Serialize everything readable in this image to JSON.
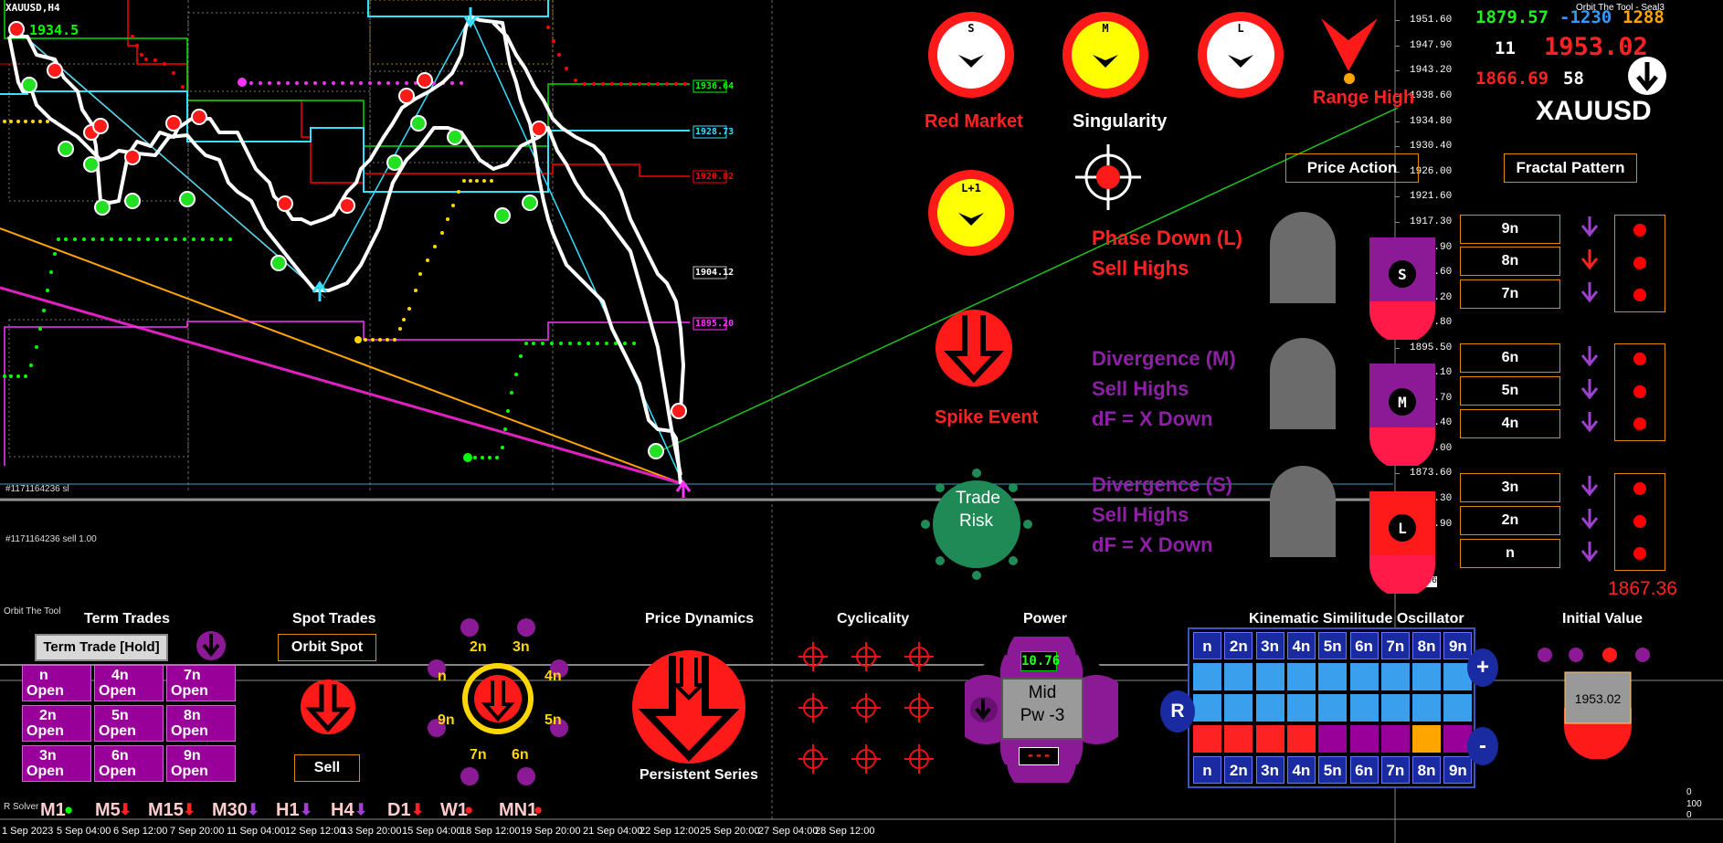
{
  "chart": {
    "symbol_label": "XAUUSD,H4",
    "indicator_title": "Orbit The Tool - Seal3",
    "level_green_label": "1934.5",
    "price_tags": [
      "1936.64",
      "1928.73",
      "1920.82",
      "1904.12",
      "1895.20"
    ],
    "trade_line_sl": "#1171164236 sl",
    "trade_line_sell": "#1171164236 sell 1.00",
    "current_price_large": "1867.36",
    "current_price_tag": "1867.36",
    "price_axis": [
      "1951.60",
      "1947.90",
      "1943.20",
      "1938.60",
      "1934.80",
      "1930.40",
      "1926.00",
      "1921.60",
      "1917.30",
      "1912.90",
      "1908.60",
      "1904.20",
      "1899.80",
      "1895.50",
      "1891.10",
      "1886.70",
      "1882.40",
      "1878.00",
      "1873.60",
      "1869.30",
      "1864.90"
    ],
    "colors": {
      "white": "#ffffff",
      "red": "#ff0000",
      "green": "#00ff00",
      "cyan": "#33e0ff",
      "magenta": "#ff33ff",
      "yellow": "#ffd700",
      "orange": "#ffa500"
    }
  },
  "header_stats": {
    "v1": "1879.57",
    "v2": "-1230",
    "v3": "1288",
    "v4": "11",
    "v5": "1953.02",
    "v6": "1866.69",
    "v7": "58",
    "symbol": "XAUUSD"
  },
  "dials": {
    "s_label": "S",
    "m_label": "M",
    "l_label": "L",
    "lp1_label": "L+1",
    "red_market": "Red Market",
    "singularity": "Singularity",
    "range_high": "Range High",
    "spike_event": "Spike Event",
    "trade_risk_line1": "Trade",
    "trade_risk_line2": "Risk"
  },
  "buttons": {
    "price_action": "Price Action",
    "fractal_pattern": "Fractal Pattern"
  },
  "phases": [
    {
      "line1": "Phase Down (L)",
      "line2": "Sell Highs",
      "line3": "",
      "badge": "S",
      "color": "#ff2222"
    },
    {
      "line1": "Divergence (M)",
      "line2": "Sell Highs",
      "line3": "dF = X Down",
      "badge": "M",
      "color": "#8e1fa6"
    },
    {
      "line1": "Divergence (S)",
      "line2": "Sell Highs",
      "line3": "dF = X Down",
      "badge": "L",
      "color": "#8e1fa6"
    }
  ],
  "fractal_rows": [
    "9n",
    "8n",
    "7n",
    "6n",
    "5n",
    "4n",
    "3n",
    "2n",
    "n"
  ],
  "bottom": {
    "panel_label": "Orbit The Tool",
    "term_trades": {
      "title": "Term Trades",
      "hold_button": "Term Trade [Hold]",
      "tiles": [
        {
          "n": "n",
          "state": "Open"
        },
        {
          "n": "4n",
          "state": "Open"
        },
        {
          "n": "7n",
          "state": "Open"
        },
        {
          "n": "2n",
          "state": "Open"
        },
        {
          "n": "5n",
          "state": "Open"
        },
        {
          "n": "8n",
          "state": "Open"
        },
        {
          "n": "3n",
          "state": "Open"
        },
        {
          "n": "6n",
          "state": "Open"
        },
        {
          "n": "9n",
          "state": "Open"
        }
      ]
    },
    "spot_trades": {
      "title": "Spot Trades",
      "orbit_spot": "Orbit Spot",
      "sell": "Sell"
    },
    "orbit_ring": {
      "labels": [
        "2n",
        "3n",
        "4n",
        "5n",
        "6n",
        "7n",
        "9n",
        "n"
      ]
    },
    "price_dynamics": {
      "title": "Price Dynamics",
      "caption": "Persistent Series"
    },
    "cyclicality": {
      "title": "Cyclicality"
    },
    "power": {
      "title": "Power",
      "value": "10.76",
      "line1": "Mid",
      "line2": "Pw -3",
      "bottom": "---"
    },
    "kso": {
      "title": "Kinematic Similitude Oscillator",
      "header": [
        "n",
        "2n",
        "3n",
        "4n",
        "5n",
        "6n",
        "7n",
        "8n",
        "9n"
      ],
      "r_label": "R",
      "plus": "+",
      "minus": "-",
      "row3_colors": [
        "#ff2222",
        "#ff2222",
        "#ff2222",
        "#ff2222",
        "#990099",
        "#990099",
        "#990099",
        "#ffa500",
        "#990099"
      ]
    },
    "initial_value": {
      "title": "Initial Value",
      "value": "1953.02"
    },
    "subwindow_label": "R Solver",
    "subwindow_axis_top": "100",
    "subwindow_axis_bottom": "0",
    "axis_zero": "0"
  },
  "timeframes": [
    {
      "label": "M1",
      "sym": "●",
      "color": "#00ff00"
    },
    {
      "label": "M5",
      "sym": "⬇",
      "color": "#ff2222"
    },
    {
      "label": "M15",
      "sym": "⬇",
      "color": "#ff2222"
    },
    {
      "label": "M30",
      "sym": "⬇",
      "color": "#a040d0"
    },
    {
      "label": "H1",
      "sym": "⬇",
      "color": "#a040d0"
    },
    {
      "label": "H4",
      "sym": "⬇",
      "color": "#a040d0"
    },
    {
      "label": "D1",
      "sym": "⬇",
      "color": "#ff2222"
    },
    {
      "label": "W1",
      "sym": "●",
      "color": "#ff2222"
    },
    {
      "label": "MN1",
      "sym": "●",
      "color": "#ff2222"
    }
  ],
  "dates": [
    "1 Sep 2023",
    "5 Sep 04:00",
    "6 Sep 12:00",
    "7 Sep 20:00",
    "11 Sep 04:00",
    "12 Sep 12:00",
    "13 Sep 20:00",
    "15 Sep 04:00",
    "18 Sep 12:00",
    "19 Sep 20:00",
    "21 Sep 04:00",
    "22 Sep 12:00",
    "25 Sep 20:00",
    "27 Sep 04:00",
    "28 Sep 12:00"
  ]
}
